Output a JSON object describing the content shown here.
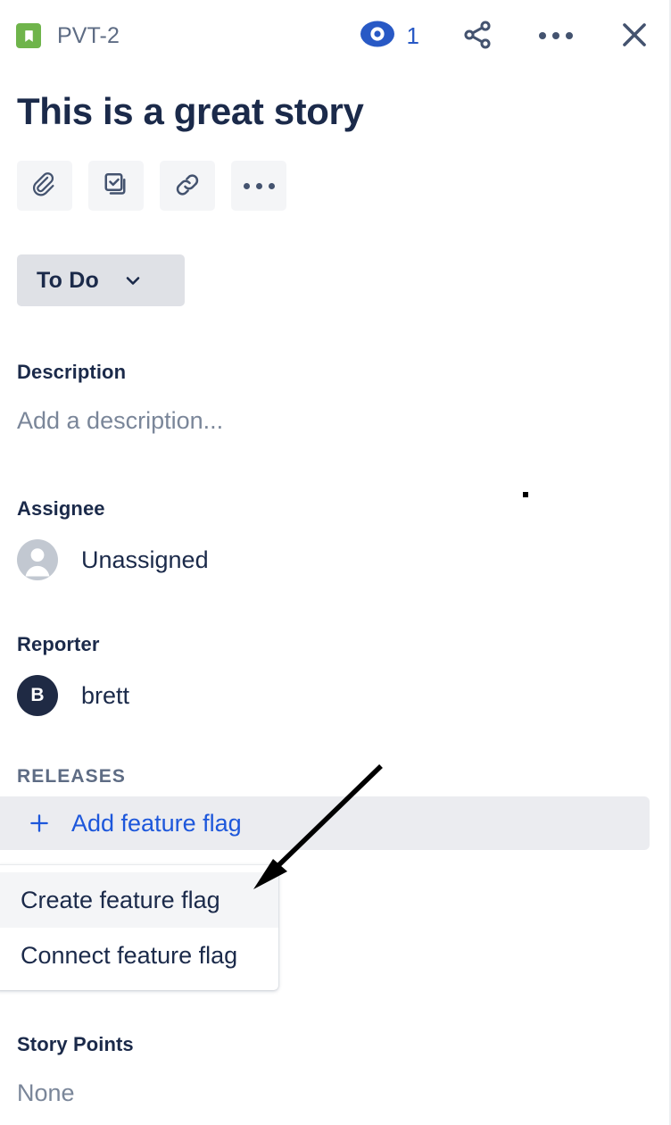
{
  "header": {
    "issue_type_icon": "story-bookmark-icon",
    "issue_key": "PVT-2",
    "watch_icon": "eye-icon",
    "watch_count": "1",
    "share_icon": "share-icon",
    "more_icon": "more-horizontal-icon",
    "close_icon": "close-icon",
    "accent_blue": "#2859C5",
    "story_green": "#6FB44B"
  },
  "issue": {
    "title": "This is a great story"
  },
  "actions": [
    {
      "name": "attach",
      "icon": "paperclip-icon"
    },
    {
      "name": "child-issue",
      "icon": "checkbox-stack-icon"
    },
    {
      "name": "link",
      "icon": "link-icon"
    },
    {
      "name": "more",
      "icon": "more-horizontal-icon"
    }
  ],
  "status": {
    "label": "To Do",
    "chevron_icon": "chevron-down-icon"
  },
  "description": {
    "label": "Description",
    "placeholder": "Add a description..."
  },
  "assignee": {
    "label": "Assignee",
    "value": "Unassigned",
    "avatar_icon": "default-person-avatar-icon"
  },
  "reporter": {
    "label": "Reporter",
    "value": "brett",
    "avatar_initial": "B"
  },
  "releases": {
    "label": "RELEASES",
    "add_label": "Add feature flag",
    "plus_icon": "plus-icon",
    "link_color": "#1D57DB"
  },
  "flag_menu": {
    "items": [
      {
        "label": "Create feature flag",
        "hovered": true
      },
      {
        "label": "Connect feature flag",
        "hovered": false
      }
    ]
  },
  "story_points": {
    "label": "Story Points",
    "value": "None"
  },
  "annotation": {
    "type": "arrow",
    "points_to": "Create feature flag",
    "color": "#000000"
  }
}
